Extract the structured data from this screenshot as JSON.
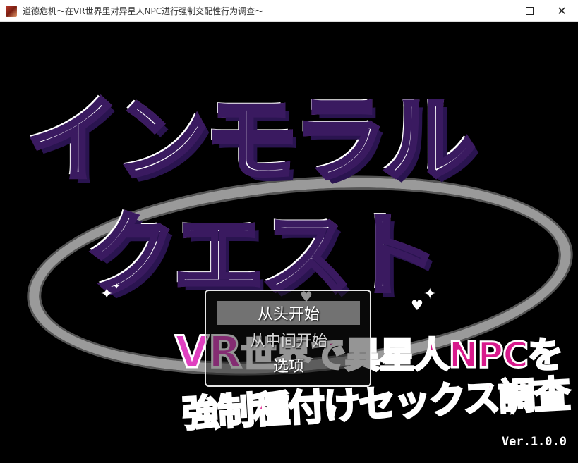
{
  "window": {
    "title": "道德危机～在VR世界里对异星人NPC进行强制交配性行为调查～",
    "app_icon": "game-app-icon",
    "controls": {
      "minimize_icon": "minimize-icon",
      "maximize_icon": "maximize-icon",
      "close_icon": "close-icon",
      "close_glyph": "✕"
    }
  },
  "logo": {
    "line1": "インモラル",
    "line2": "クエスト",
    "subtitle_vr": "VR",
    "subtitle_line1": "世界で異星人NPCを",
    "subtitle_line2": "強制種付けセックス調査",
    "decorations": [
      "sparkle-icon",
      "heart-icon"
    ]
  },
  "menu": {
    "items": [
      {
        "label": "从头开始",
        "selected": true
      },
      {
        "label": "从中间开始",
        "selected": false
      },
      {
        "label": "选项",
        "selected": false
      }
    ]
  },
  "version": "Ver.1.0.0",
  "colors": {
    "logo_purple": "#8a1fb8",
    "logo_outline": "#3a1a60",
    "subtitle_pink": "#e0188a",
    "background": "#000000"
  }
}
